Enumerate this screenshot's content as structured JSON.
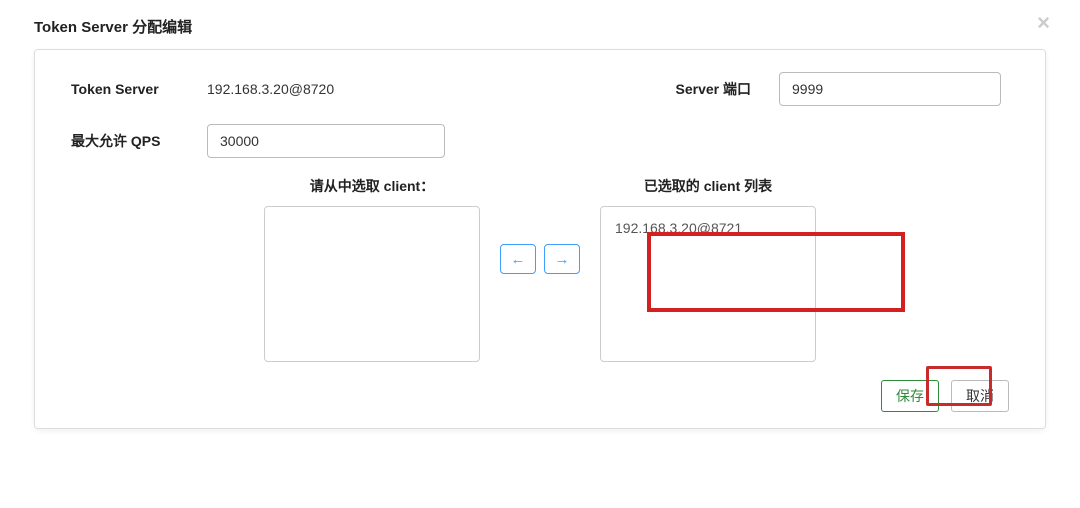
{
  "dialog": {
    "title": "Token Server 分配编辑",
    "close_label": "×"
  },
  "form": {
    "token_server_label": "Token Server",
    "token_server_value": "192.168.3.20@8720",
    "server_port_label": "Server 端口",
    "server_port_value": "9999",
    "max_qps_label": "最大允许 QPS",
    "max_qps_value": "30000"
  },
  "transfer": {
    "available_title": "请从中选取 client：",
    "selected_title": "已选取的 client 列表",
    "available_items": [],
    "selected_items": [
      "192.168.3.20@8721"
    ],
    "arrow_left": "←",
    "arrow_right": "→"
  },
  "footer": {
    "save_label": "保存",
    "cancel_label": "取消"
  }
}
